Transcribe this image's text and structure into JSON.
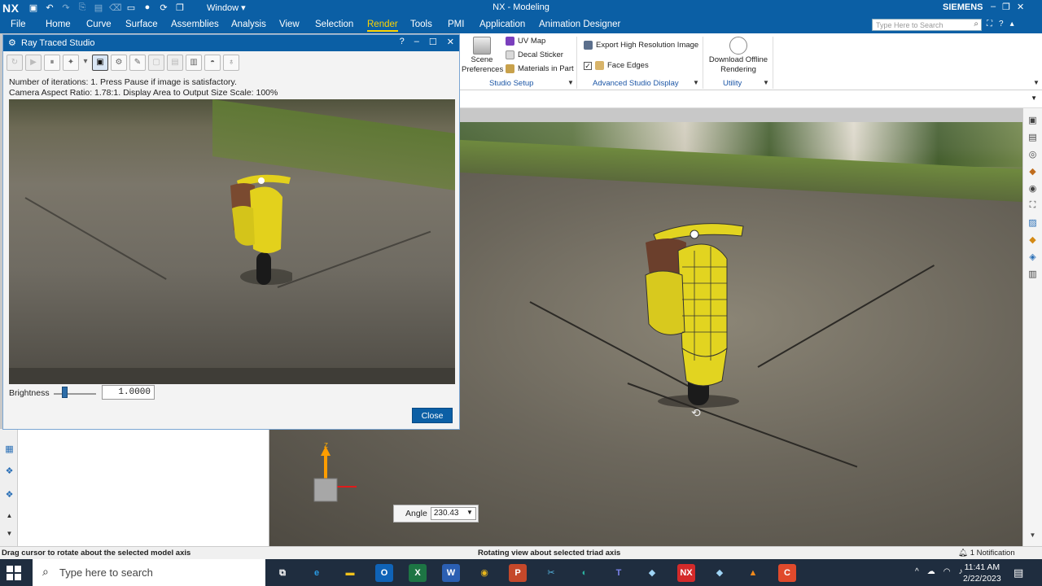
{
  "app": {
    "logo": "NX",
    "title": "NX - Modeling",
    "brand": "SIEMENS",
    "window_menu": "Window"
  },
  "menu": {
    "items": [
      "File",
      "Home",
      "Curve",
      "Surface",
      "Assemblies",
      "Analysis",
      "View",
      "Selection",
      "Render",
      "Tools",
      "PMI",
      "Application",
      "Animation Designer"
    ],
    "active": "Render",
    "search_placeholder": "Type Here to Search"
  },
  "ribbon": {
    "scene_preferences": "Scene Preferences",
    "uv_map": "UV Map",
    "decal_sticker": "Decal Sticker",
    "materials_in_part": "Materials in Part",
    "studio_setup_label": "Studio Setup",
    "export_high_res": "Export High Resolution Image",
    "face_edges": "Face Edges",
    "advanced_studio_display_label": "Advanced Studio Display",
    "download_offline": "Download Offline Rendering",
    "utility_label": "Utility"
  },
  "dialog": {
    "title": "Ray Traced Studio",
    "status_line1": "Number of iterations: 1.  Press Pause if image is satisfactory.",
    "status_line2": "Camera Aspect Ratio: 1.78:1. Display Area to Output Size Scale: 100%",
    "brightness_label": "Brightness",
    "brightness_value": "1.0000",
    "brightness_level": 0.25,
    "close_label": "Close"
  },
  "viewport": {
    "angle_label": "Angle",
    "angle_value": "230.43",
    "triad_z_label": "Z"
  },
  "statusbar": {
    "left": "Drag cursor to rotate about the selected model axis",
    "center": "Rotating view about selected triad axis",
    "right": "1 Notification"
  },
  "taskbar": {
    "search_placeholder": "Type here to search",
    "time": "11:41 AM",
    "date": "2/22/2023"
  },
  "colors": {
    "title_blue": "#0b5fa5",
    "active_menu": "#ffd400",
    "scooter_yellow": "#e2d420"
  }
}
